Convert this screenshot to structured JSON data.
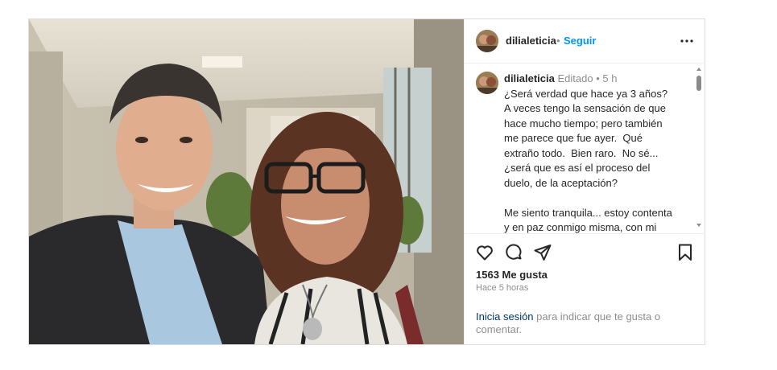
{
  "post": {
    "username": "dilialeticia",
    "follow_label": "Seguir",
    "separator": "•",
    "edited_label": "Editado",
    "meta_dot": "•",
    "time_ago_short": "5 h",
    "caption_p1": "¿Será verdad que hace ya 3 años?  A veces tengo la sensación de que hace mucho tiempo; pero también me parece que fue ayer.  Qué extraño todo.  Bien raro.  No sé... ¿será que es así el proceso del duelo, de la aceptación?",
    "caption_p2": "Me siento tranquila... estoy contenta y en paz conmigo misma, con mi vida y con mi trabajo... este año me siento mucho mejor, con mas energía. Pero...",
    "likes": "1563 Me gusta",
    "timestamp": "Hace 5 horas",
    "login_link": "Inicia sesión",
    "login_text": " para indicar que te gusta o comentar."
  },
  "icons": {
    "more": "more-options-icon",
    "like": "heart-icon",
    "comment": "comment-icon",
    "share": "share-icon",
    "save": "bookmark-icon"
  },
  "colors": {
    "link_blue": "#0095f6",
    "login_link": "#00376b",
    "muted": "#8e8e8e",
    "border": "#dbdbdb"
  }
}
